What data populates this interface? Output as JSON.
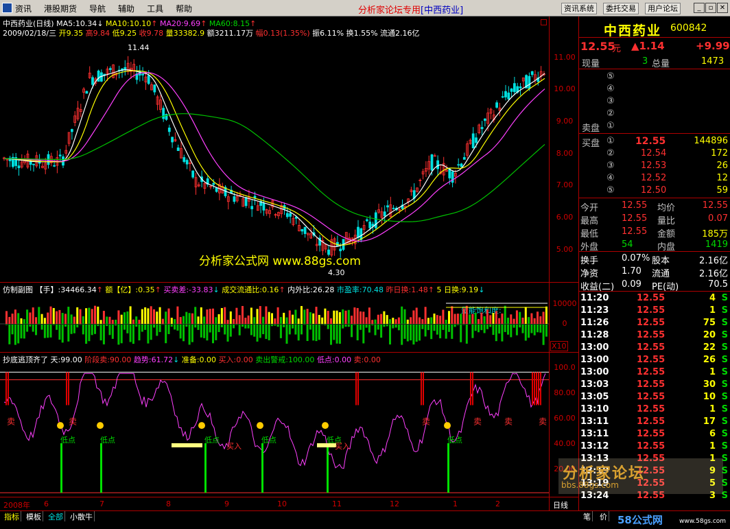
{
  "menu": {
    "items": [
      "资讯",
      "港股期货",
      "导航",
      "辅助",
      "工具",
      "帮助"
    ],
    "title": "分析家论坛专用",
    "title_stock": "[中西药业]",
    "buttons": [
      "资讯系统",
      "委托交易",
      "用户论坛"
    ]
  },
  "kline": {
    "label": "中西药业(日线)",
    "ma5": "MA5:10.34",
    "ma10": "MA10:10.10",
    "ma20": "MA20:9.69",
    "ma60": "MA60:8.15",
    "date": "2009/02/18/三",
    "open": "开9.35",
    "high": "高9.84",
    "low": "低9.25",
    "close": "收9.78",
    "vol": "量33382.9",
    "amount": "额3211.17万",
    "change": "幅0.13(1.35%)",
    "zhen": "振6.11%",
    "huan": "换1.55%",
    "liutong": "流通2.16亿",
    "peak": "11.44",
    "trough": "4.30",
    "watermark": "分析家公式网 www.88gs.com",
    "yticks": [
      "11.00",
      "10.00",
      "9.00",
      "8.00",
      "7.00",
      "6.00",
      "5.00"
    ]
  },
  "sub1": {
    "label": "仿制副图",
    "shou": "【手】:34466.34",
    "e": "额【亿】:0.35",
    "maimai": "买卖差:-33.83",
    "chengjiao": "成交流通比:0.16",
    "neiwai": "内外比:26.28",
    "shiying": "市盈率:70.48",
    "zuori": "昨日换:1.48",
    "wuri": "5 日换:9.19",
    "label2": "量能饱和度:",
    "yticks": [
      "10000",
      "0"
    ],
    "x10": "X10"
  },
  "sub2": {
    "label": "抄底逃顶齐了",
    "tian": "天:99.00",
    "jieduan": "阶段卖:90.00",
    "qushi": "趋势:61.72",
    "zhunbei": "准备:0.00",
    "mairu": "买入:0.00",
    "maichu": "卖出警戒:100.00",
    "didian": "低点:0.00",
    "mai": "卖:0.00",
    "yticks": [
      "100.0",
      "80.00",
      "60.00",
      "40.00",
      "20.00"
    ],
    "low_labels": [
      "低点",
      "低点",
      "低点",
      "低点",
      "低点",
      "低点"
    ],
    "sell_label": "卖",
    "buy_label": "买入"
  },
  "xaxis": {
    "labels": [
      "2008年",
      "6",
      "7",
      "8",
      "9",
      "10",
      "11",
      "12",
      "1",
      "2"
    ],
    "right": "日线"
  },
  "quote": {
    "name": "中西药业",
    "code": "600842",
    "price": "12.55",
    "unit": "元",
    "change": "▲1.14",
    "pct": "+9.99",
    "xianliang_label": "现量",
    "xianliang": "3",
    "zongliang_label": "总量",
    "zongliang": "1473",
    "sell_label": "卖盘",
    "buy_label": "买盘",
    "sell_levels": [
      "⑤",
      "④",
      "③",
      "②",
      "①"
    ],
    "buy_levels": [
      {
        "n": "①",
        "p": "12.55",
        "v": "144896"
      },
      {
        "n": "②",
        "p": "12.54",
        "v": "172"
      },
      {
        "n": "③",
        "p": "12.53",
        "v": "26"
      },
      {
        "n": "④",
        "p": "12.52",
        "v": "12"
      },
      {
        "n": "⑤",
        "p": "12.50",
        "v": "59"
      }
    ],
    "stats": [
      [
        "今开",
        "12.55",
        "均价",
        "12.55"
      ],
      [
        "最高",
        "12.55",
        "量比",
        "0.07"
      ],
      [
        "最低",
        "12.55",
        "金额",
        "185万"
      ],
      [
        "外盘",
        "54",
        "内盘",
        "1419"
      ]
    ],
    "fund": [
      [
        "换手",
        "0.07%",
        "股本",
        "2.16亿"
      ],
      [
        "净资",
        "1.70",
        "流通",
        "2.16亿"
      ],
      [
        "收益(二)",
        "0.09",
        "PE(动)",
        "70.5"
      ]
    ],
    "ticks": [
      [
        "11:20",
        "12.55",
        "4",
        "S"
      ],
      [
        "11:23",
        "12.55",
        "1",
        "S"
      ],
      [
        "11:26",
        "12.55",
        "75",
        "S"
      ],
      [
        "11:28",
        "12.55",
        "20",
        "S"
      ],
      [
        "13:00",
        "12.55",
        "22",
        "S"
      ],
      [
        "13:00",
        "12.55",
        "26",
        "S"
      ],
      [
        "13:00",
        "12.55",
        "1",
        "S"
      ],
      [
        "13:03",
        "12.55",
        "30",
        "S"
      ],
      [
        "13:05",
        "12.55",
        "10",
        "S"
      ],
      [
        "13:10",
        "12.55",
        "1",
        "S"
      ],
      [
        "13:11",
        "12.55",
        "17",
        "S"
      ],
      [
        "13:11",
        "12.55",
        "6",
        "S"
      ],
      [
        "13:12",
        "12.55",
        "1",
        "S"
      ],
      [
        "13:13",
        "12.55",
        "1",
        "S"
      ],
      [
        "13:19",
        "12.55",
        "9",
        "S"
      ],
      [
        "13:19",
        "12.55",
        "5",
        "S"
      ],
      [
        "13:24",
        "12.55",
        "3",
        "S"
      ]
    ]
  },
  "bottom": {
    "tabs": [
      "指标",
      "模板",
      "全部",
      "小散牛"
    ],
    "right_tabs": [
      "笔",
      "价"
    ],
    "logo": "58公式网",
    "site": "www.58gs.com",
    "forum_logo": "分析家论坛",
    "forum_site": "bbs.88gs.com"
  }
}
